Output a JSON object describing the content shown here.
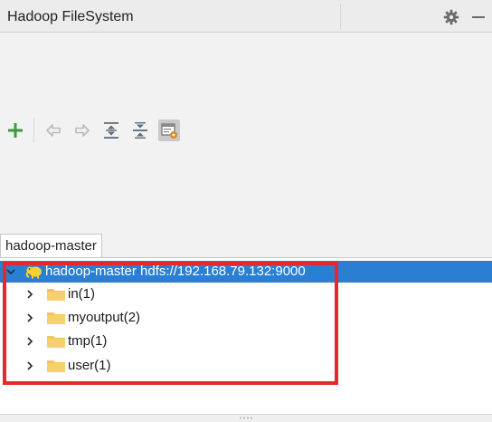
{
  "panel": {
    "title": "Hadoop FileSystem"
  },
  "header_icons": [
    "gear-icon",
    "minimize-icon"
  ],
  "toolbar": {
    "buttons": [
      "add-icon",
      "back-icon",
      "forward-icon",
      "expand-all-icon",
      "collapse-all-icon",
      "show-options-icon"
    ]
  },
  "tabs": [
    {
      "label": "hadoop-master"
    }
  ],
  "tree": {
    "root": {
      "label": "hadoop-master hdfs://192.168.79.132:9000",
      "expanded": true,
      "selected": true
    },
    "children": [
      {
        "label": "in(1)"
      },
      {
        "label": "myoutput(2)"
      },
      {
        "label": "tmp(1)"
      },
      {
        "label": "user(1)"
      }
    ]
  },
  "colors": {
    "selection": "#2a7fd2",
    "annotation_box": "#e8262b",
    "folder": "#f2c55c",
    "add": "#3c9a3c"
  }
}
